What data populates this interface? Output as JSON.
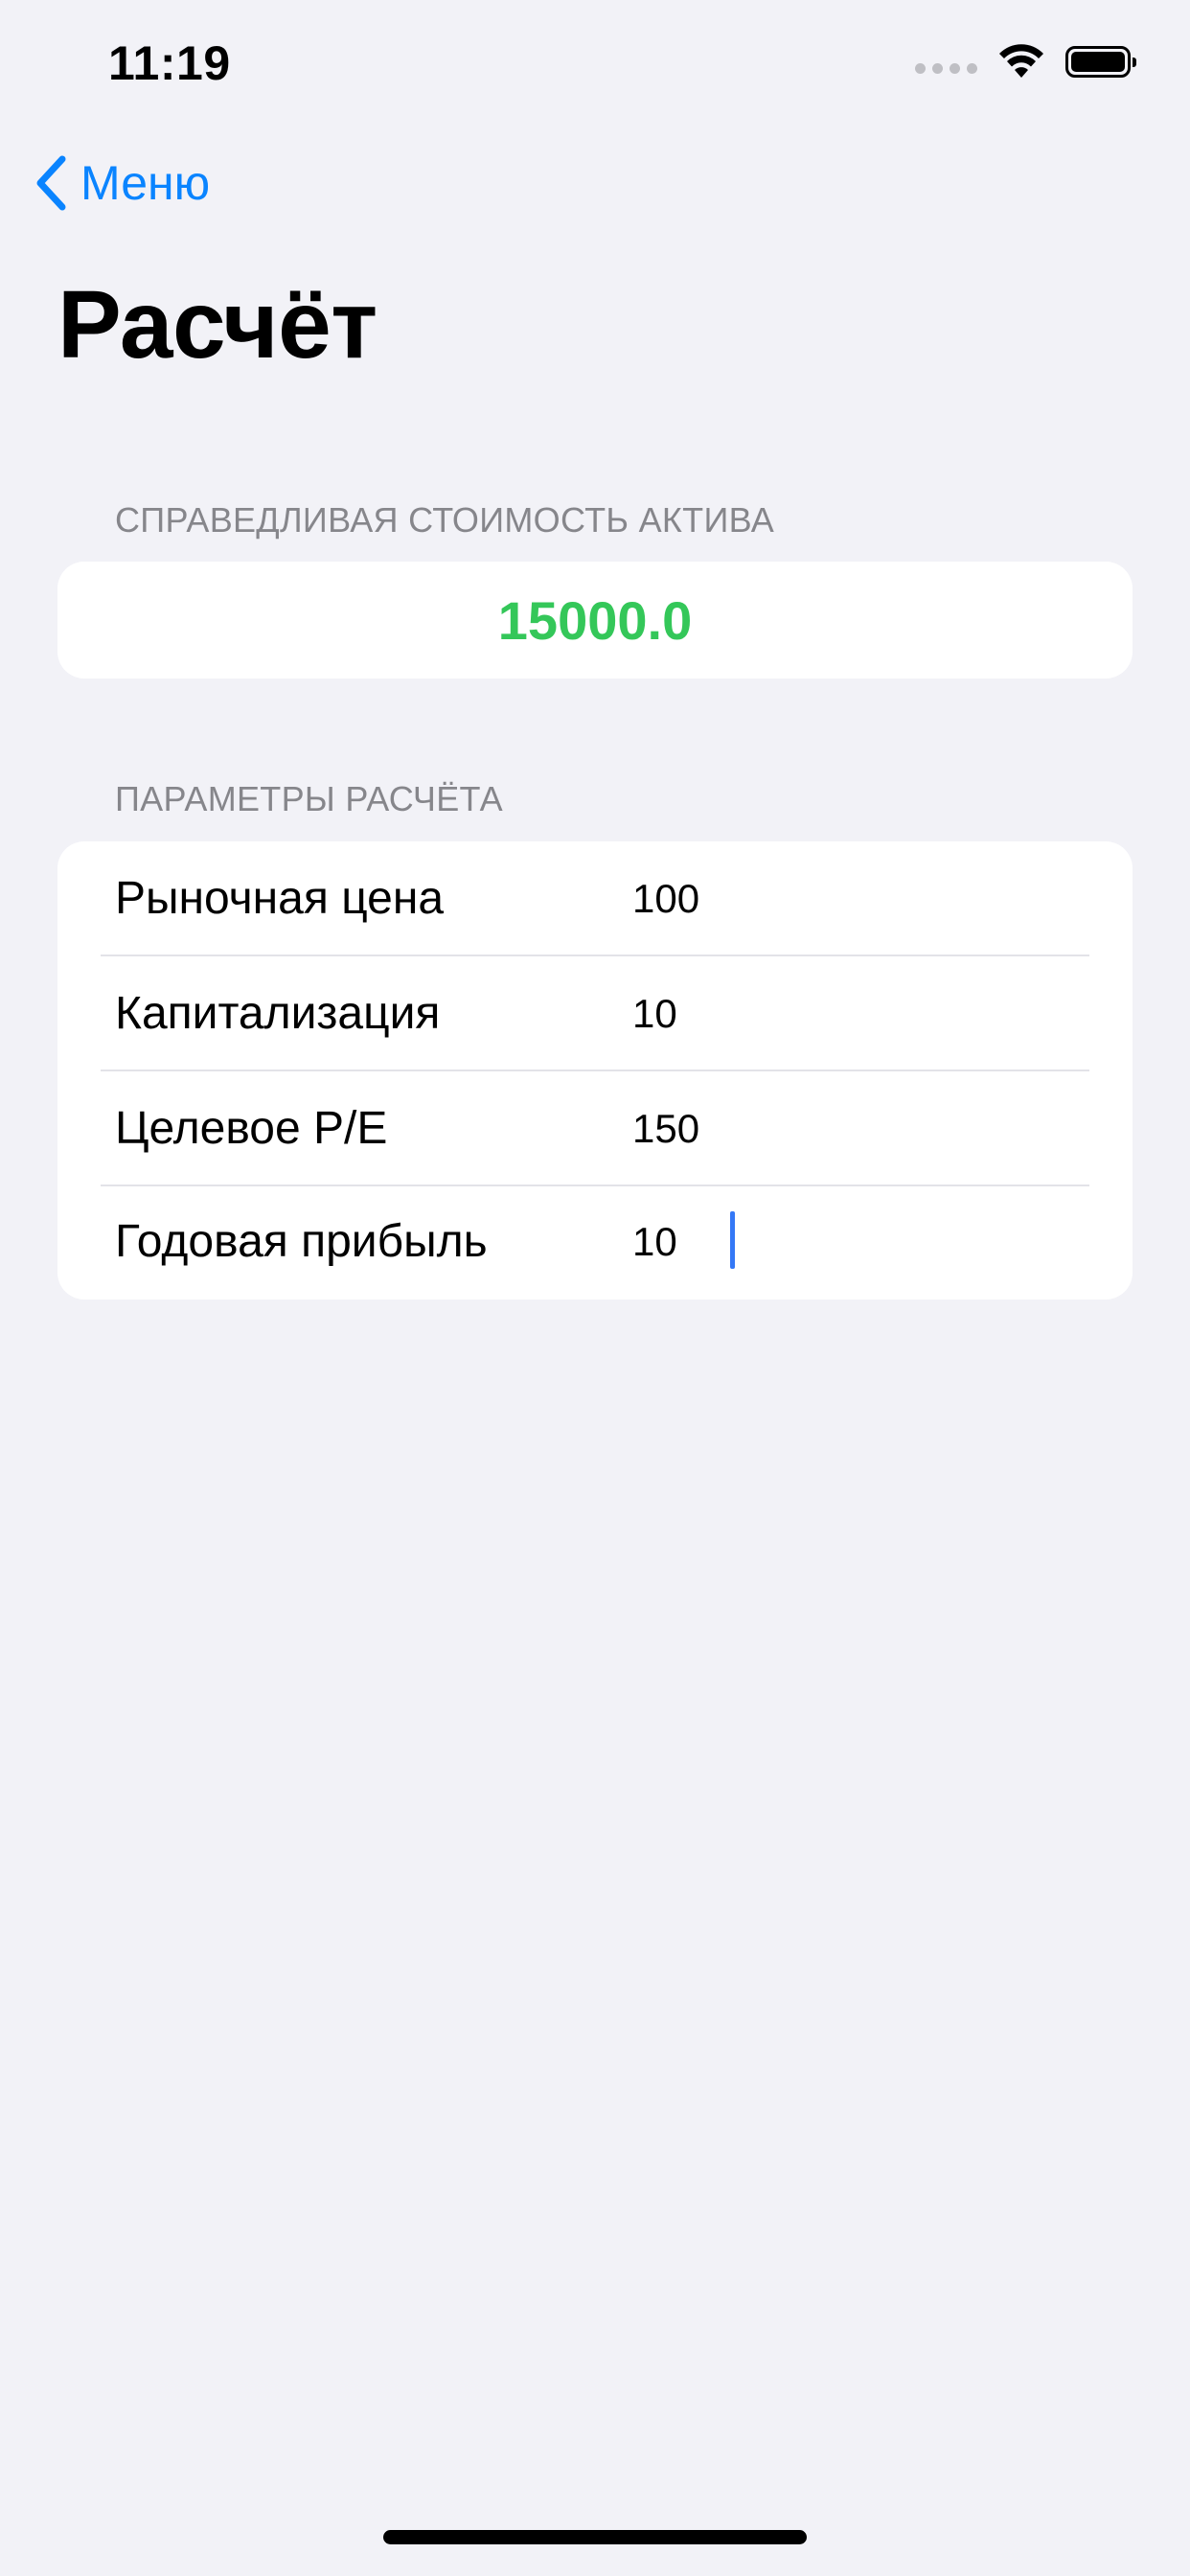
{
  "status_bar": {
    "time": "11:19"
  },
  "nav": {
    "back_label": "Меню",
    "title": "Расчёт"
  },
  "result_section": {
    "header": "СПРАВЕДЛИВАЯ СТОИМОСТЬ АКТИВА",
    "value": "15000.0",
    "value_color": "#34C759"
  },
  "params_section": {
    "header": "ПАРАМЕТРЫ РАСЧЁТА",
    "rows": [
      {
        "label": "Рыночная цена",
        "value": "100"
      },
      {
        "label": "Капитализация",
        "value": "10"
      },
      {
        "label": "Целевое P/E",
        "value": "150"
      },
      {
        "label": "Годовая прибыль",
        "value": "10",
        "focused": true
      }
    ]
  },
  "colors": {
    "accent": "#0A84FF",
    "background": "#F2F2F7",
    "result_green": "#34C759"
  },
  "icons": {
    "back": "chevron-left-icon",
    "wifi": "wifi-icon",
    "battery": "battery-icon",
    "cellular": "cellular-signal-icon"
  }
}
